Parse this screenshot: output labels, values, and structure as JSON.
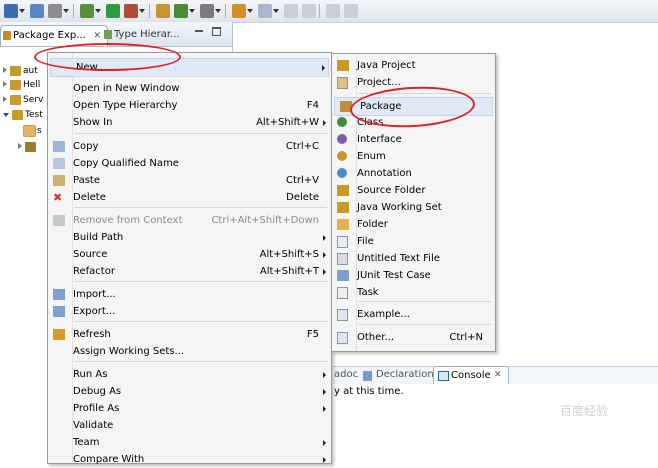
{
  "toolbar": {
    "icons": [
      "new-icon",
      "save-icon",
      "print-icon",
      "debug-icon",
      "run-icon",
      "external-tools-icon",
      "new-java-package-icon",
      "new-java-class-icon",
      "open-type-icon",
      "search-icon",
      "annotation-icon",
      "next-annotation-icon",
      "prev-annotation-icon",
      "back-icon",
      "forward-icon"
    ]
  },
  "left_tabs": {
    "package_explorer": "Package Exp...",
    "type_hierarchy": "Type Hierar..."
  },
  "tree": [
    {
      "label": "aut",
      "expanded": false
    },
    {
      "label": "Hell",
      "expanded": false
    },
    {
      "label": "Serv",
      "expanded": false
    },
    {
      "label": "Test",
      "expanded": true
    },
    {
      "label": "s",
      "expanded": false
    },
    {
      "label": "",
      "expanded": false
    }
  ],
  "bottom_tabs": {
    "javadoc": "adoc",
    "declaration": "Declaration",
    "console": "Console"
  },
  "console": {
    "text": "y at this time."
  },
  "context_menu": [
    {
      "label": "New",
      "shortcut": "",
      "submenu": true,
      "highlight": true
    },
    {
      "sep": true
    },
    {
      "label": "Open in New Window",
      "shortcut": "",
      "submenu": false
    },
    {
      "label": "Open Type Hierarchy",
      "shortcut": "F4",
      "submenu": false
    },
    {
      "label": "Show In",
      "shortcut": "Alt+Shift+W",
      "submenu": true
    },
    {
      "sep": true
    },
    {
      "label": "Copy",
      "shortcut": "Ctrl+C",
      "icon": "copy-icon"
    },
    {
      "label": "Copy Qualified Name",
      "shortcut": "",
      "icon": "copy-qualified-icon"
    },
    {
      "label": "Paste",
      "shortcut": "Ctrl+V",
      "icon": "paste-icon"
    },
    {
      "label": "Delete",
      "shortcut": "Delete",
      "icon": "delete-icon"
    },
    {
      "sep": true
    },
    {
      "label": "Remove from Context",
      "shortcut": "Ctrl+Alt+Shift+Down",
      "disabled": true,
      "icon": "remove-context-icon"
    },
    {
      "label": "Build Path",
      "shortcut": "",
      "submenu": true
    },
    {
      "label": "Source",
      "shortcut": "Alt+Shift+S",
      "submenu": true
    },
    {
      "label": "Refactor",
      "shortcut": "Alt+Shift+T",
      "submenu": true
    },
    {
      "sep": true
    },
    {
      "label": "Import...",
      "shortcut": "",
      "icon": "import-icon"
    },
    {
      "label": "Export...",
      "shortcut": "",
      "icon": "export-icon"
    },
    {
      "sep": true
    },
    {
      "label": "Refresh",
      "shortcut": "F5",
      "icon": "refresh-icon"
    },
    {
      "label": "Assign Working Sets...",
      "shortcut": ""
    },
    {
      "sep": true
    },
    {
      "label": "Run As",
      "shortcut": "",
      "submenu": true
    },
    {
      "label": "Debug As",
      "shortcut": "",
      "submenu": true
    },
    {
      "label": "Profile As",
      "shortcut": "",
      "submenu": true
    },
    {
      "label": "Validate",
      "shortcut": ""
    },
    {
      "label": "Team",
      "shortcut": "",
      "submenu": true
    },
    {
      "label": "Compare With",
      "shortcut": "",
      "submenu": true
    }
  ],
  "submenu_new": [
    {
      "label": "Java Project",
      "icon": "java-project-icon"
    },
    {
      "label": "Project...",
      "icon": "project-icon"
    },
    {
      "sep": true
    },
    {
      "label": "Package",
      "icon": "package-icon",
      "highlight": true
    },
    {
      "label": "Class",
      "icon": "class-icon"
    },
    {
      "label": "Interface",
      "icon": "interface-icon"
    },
    {
      "label": "Enum",
      "icon": "enum-icon"
    },
    {
      "label": "Annotation",
      "icon": "annotation-type-icon"
    },
    {
      "label": "Source Folder",
      "icon": "source-folder-icon"
    },
    {
      "label": "Java Working Set",
      "icon": "working-set-icon"
    },
    {
      "label": "Folder",
      "icon": "folder-icon"
    },
    {
      "label": "File",
      "icon": "file-icon"
    },
    {
      "label": "Untitled Text File",
      "icon": "text-file-icon"
    },
    {
      "label": "JUnit Test Case",
      "icon": "junit-icon"
    },
    {
      "label": "Task",
      "icon": "task-icon"
    },
    {
      "sep": true
    },
    {
      "label": "Example...",
      "icon": "example-icon"
    },
    {
      "sep": true
    },
    {
      "label": "Other...",
      "icon": "other-icon",
      "shortcut": "Ctrl+N"
    }
  ],
  "watermark": "百度经验",
  "colors": {
    "annotation_red": "#d9252a",
    "highlight": "#dfe9f7",
    "menu_bg": "#f5f5f5"
  }
}
